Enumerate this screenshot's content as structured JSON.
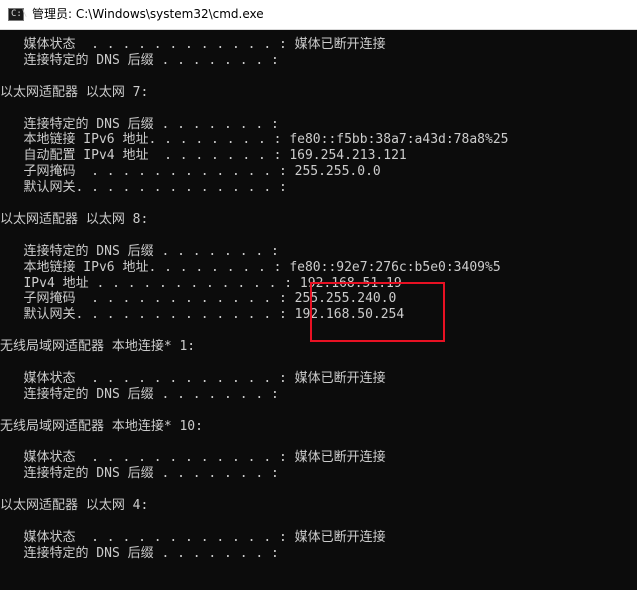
{
  "window": {
    "title": "管理员: C:\\Windows\\system32\\cmd.exe",
    "icon": "cmd-icon"
  },
  "console": {
    "lines": [
      "   媒体状态  . . . . . . . . . . . . : 媒体已断开连接",
      "   连接特定的 DNS 后缀 . . . . . . . :",
      "",
      "以太网适配器 以太网 7:",
      "",
      "   连接特定的 DNS 后缀 . . . . . . . :",
      "   本地链接 IPv6 地址. . . . . . . . : fe80::f5bb:38a7:a43d:78a8%25",
      "   自动配置 IPv4 地址  . . . . . . . : 169.254.213.121",
      "   子网掩码  . . . . . . . . . . . . : 255.255.0.0",
      "   默认网关. . . . . . . . . . . . . :",
      "",
      "以太网适配器 以太网 8:",
      "",
      "   连接特定的 DNS 后缀 . . . . . . . :",
      "   本地链接 IPv6 地址. . . . . . . . : fe80::92e7:276c:b5e0:3409%5",
      "   IPv4 地址 . . . . . . . . . . . . : 192.168.51.19",
      "   子网掩码  . . . . . . . . . . . . : 255.255.240.0",
      "   默认网关. . . . . . . . . . . . . : 192.168.50.254",
      "",
      "无线局域网适配器 本地连接* 1:",
      "",
      "   媒体状态  . . . . . . . . . . . . : 媒体已断开连接",
      "   连接特定的 DNS 后缀 . . . . . . . :",
      "",
      "无线局域网适配器 本地连接* 10:",
      "",
      "   媒体状态  . . . . . . . . . . . . : 媒体已断开连接",
      "   连接特定的 DNS 后缀 . . . . . . . :",
      "",
      "以太网适配器 以太网 4:",
      "",
      "   媒体状态  . . . . . . . . . . . . : 媒体已断开连接",
      "   连接特定的 DNS 后缀 . . . . . . . :"
    ]
  },
  "colors": {
    "console_background": "#0c0c0c",
    "console_text": "#cccccc",
    "highlight_border": "#e81123"
  }
}
